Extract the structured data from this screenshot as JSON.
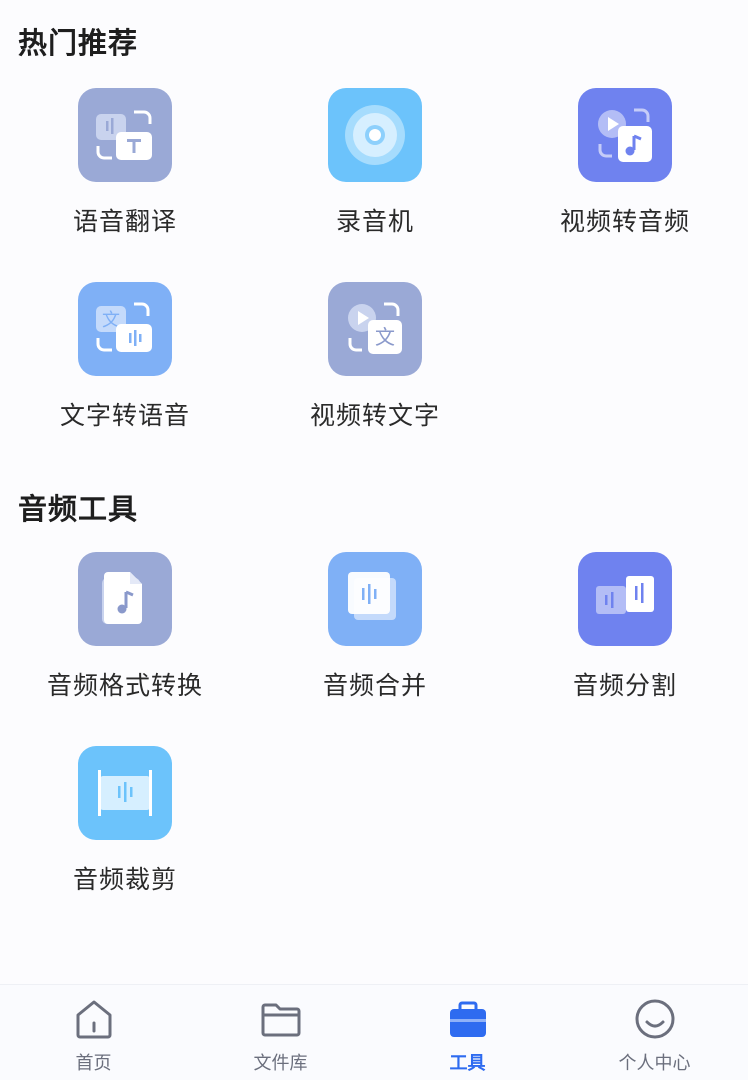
{
  "sections": {
    "hot": {
      "title": "热门推荐",
      "items": [
        {
          "label": "语音翻译",
          "icon": "speech-translate-icon",
          "color": "#9aa9d6"
        },
        {
          "label": "录音机",
          "icon": "recorder-icon",
          "color": "#6cc3fb"
        },
        {
          "label": "视频转音频",
          "icon": "video-to-audio-icon",
          "color": "#6f82ef"
        },
        {
          "label": "文字转语音",
          "icon": "text-to-speech-icon",
          "color": "#7fb0f6"
        },
        {
          "label": "视频转文字",
          "icon": "video-to-text-icon",
          "color": "#9aa9d6"
        }
      ]
    },
    "audio": {
      "title": "音频工具",
      "items": [
        {
          "label": "音频格式转换",
          "icon": "audio-format-convert-icon",
          "color": "#9aa9d6"
        },
        {
          "label": "音频合并",
          "icon": "audio-merge-icon",
          "color": "#7fb0f6"
        },
        {
          "label": "音频分割",
          "icon": "audio-split-icon",
          "color": "#6f82ef"
        },
        {
          "label": "音频裁剪",
          "icon": "audio-trim-icon",
          "color": "#6cc3fb"
        }
      ]
    }
  },
  "tabbar": {
    "items": [
      {
        "label": "首页",
        "icon": "home-icon"
      },
      {
        "label": "文件库",
        "icon": "folder-icon"
      },
      {
        "label": "工具",
        "icon": "toolbox-icon",
        "active": true
      },
      {
        "label": "个人中心",
        "icon": "smiley-user-icon"
      }
    ],
    "active_color": "#2e6bf0",
    "inactive_color": "#6b6f7d"
  }
}
